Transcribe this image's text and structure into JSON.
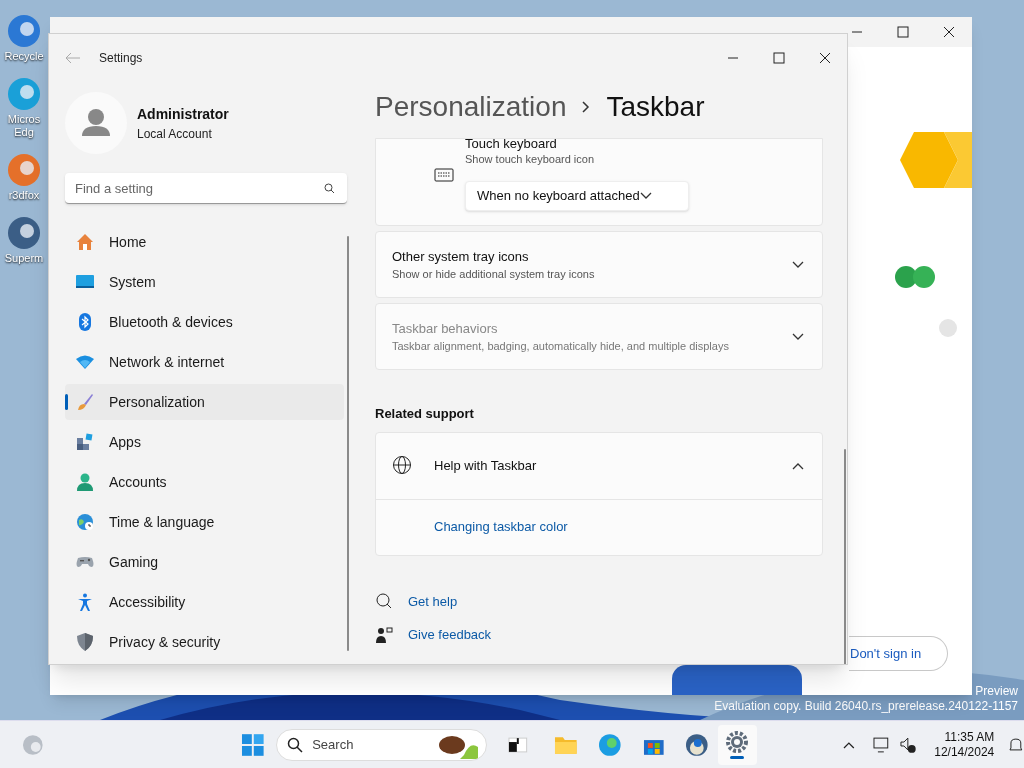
{
  "desktop": {
    "icons": [
      {
        "label": "Recycle"
      },
      {
        "label": "Micros",
        "label_2": "Edg"
      },
      {
        "label": "r3dfox"
      },
      {
        "label": "Superm"
      }
    ],
    "build_text": [
      "Preview",
      "Evaluation copy. Build 26040.rs_prerelease.240122-1157"
    ]
  },
  "browser_window": {
    "sign_in_button": "Don't sign in"
  },
  "settings": {
    "title": "Settings",
    "user": {
      "name": "Administrator",
      "account": "Local Account"
    },
    "search": {
      "placeholder": "Find a setting"
    },
    "nav": [
      {
        "label": "Home",
        "selected": false
      },
      {
        "label": "System",
        "selected": false
      },
      {
        "label": "Bluetooth & devices",
        "selected": false
      },
      {
        "label": "Network & internet",
        "selected": false
      },
      {
        "label": "Personalization",
        "selected": true
      },
      {
        "label": "Apps",
        "selected": false
      },
      {
        "label": "Accounts",
        "selected": false
      },
      {
        "label": "Time & language",
        "selected": false
      },
      {
        "label": "Gaming",
        "selected": false
      },
      {
        "label": "Accessibility",
        "selected": false
      },
      {
        "label": "Privacy & security",
        "selected": false
      }
    ],
    "breadcrumb": [
      "Personalization",
      "Taskbar"
    ],
    "touch_keyboard": {
      "title": "Touch keyboard",
      "description": "Show touch keyboard icon",
      "dropdown": "When no keyboard attached"
    },
    "expanders": [
      {
        "title": "Other system tray icons",
        "description": "Show or hide additional system tray icons",
        "expanded": false,
        "disabled": false
      },
      {
        "title": "Taskbar behaviors",
        "description": "Taskbar alignment, badging, automatically hide, and multiple displays",
        "expanded": false,
        "disabled": true
      }
    ],
    "related_heading": "Related support",
    "help": {
      "title": "Help with Taskbar",
      "expanded": true,
      "link": "Changing taskbar color"
    },
    "footer_links": [
      "Get help",
      "Give feedback"
    ]
  },
  "taskbar": {
    "search_placeholder": "Search",
    "time": "11:35 AM",
    "date": "12/14/2024"
  }
}
